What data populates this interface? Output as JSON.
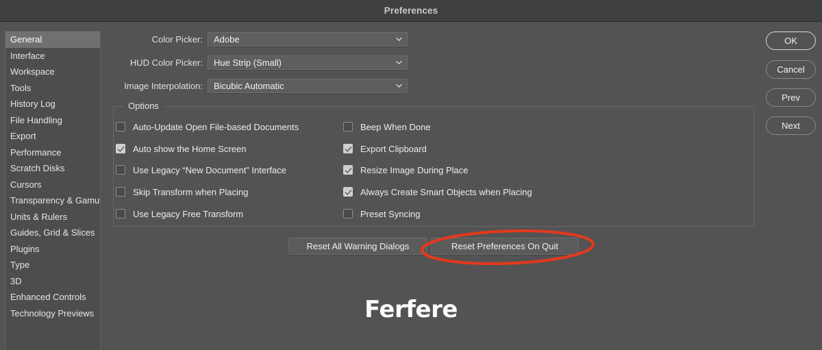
{
  "window": {
    "title": "Preferences"
  },
  "sidebar": {
    "items": [
      {
        "label": "General",
        "selected": true
      },
      {
        "label": "Interface",
        "selected": false
      },
      {
        "label": "Workspace",
        "selected": false
      },
      {
        "label": "Tools",
        "selected": false
      },
      {
        "label": "History Log",
        "selected": false
      },
      {
        "label": "File Handling",
        "selected": false
      },
      {
        "label": "Export",
        "selected": false
      },
      {
        "label": "Performance",
        "selected": false
      },
      {
        "label": "Scratch Disks",
        "selected": false
      },
      {
        "label": "Cursors",
        "selected": false
      },
      {
        "label": "Transparency & Gamut",
        "selected": false
      },
      {
        "label": "Units & Rulers",
        "selected": false
      },
      {
        "label": "Guides, Grid & Slices",
        "selected": false
      },
      {
        "label": "Plugins",
        "selected": false
      },
      {
        "label": "Type",
        "selected": false
      },
      {
        "label": "3D",
        "selected": false
      },
      {
        "label": "Enhanced Controls",
        "selected": false
      },
      {
        "label": "Technology Previews",
        "selected": false
      }
    ]
  },
  "fields": [
    {
      "label": "Color Picker:",
      "value": "Adobe"
    },
    {
      "label": "HUD Color Picker:",
      "value": "Hue Strip (Small)"
    },
    {
      "label": "Image Interpolation:",
      "value": "Bicubic Automatic"
    }
  ],
  "options": {
    "legend": "Options",
    "left_column": [
      {
        "label": "Auto-Update Open File-based Documents",
        "checked": false
      },
      {
        "label": "Auto show the Home Screen",
        "checked": true
      },
      {
        "label": "Use Legacy “New Document” Interface",
        "checked": false
      },
      {
        "label": "Skip Transform when Placing",
        "checked": false
      },
      {
        "label": "Use Legacy Free Transform",
        "checked": false
      }
    ],
    "right_column": [
      {
        "label": "Beep When Done",
        "checked": false
      },
      {
        "label": "Export Clipboard",
        "checked": true
      },
      {
        "label": "Resize Image During Place",
        "checked": true
      },
      {
        "label": "Always Create Smart Objects when Placing",
        "checked": true
      },
      {
        "label": "Preset Syncing",
        "checked": false
      }
    ]
  },
  "reset_buttons": [
    {
      "label": "Reset All Warning Dialogs"
    },
    {
      "label": "Reset Preferences On Quit"
    }
  ],
  "action_buttons": [
    {
      "label": "OK",
      "primary": true
    },
    {
      "label": "Cancel",
      "primary": false
    },
    {
      "label": "Prev",
      "primary": false
    },
    {
      "label": "Next",
      "primary": false
    }
  ],
  "annotation": {
    "color": "#e03a20",
    "target": "Reset Preferences On Quit"
  },
  "logo": {
    "text": "Ferfere",
    "color": "#fbfbfb"
  }
}
